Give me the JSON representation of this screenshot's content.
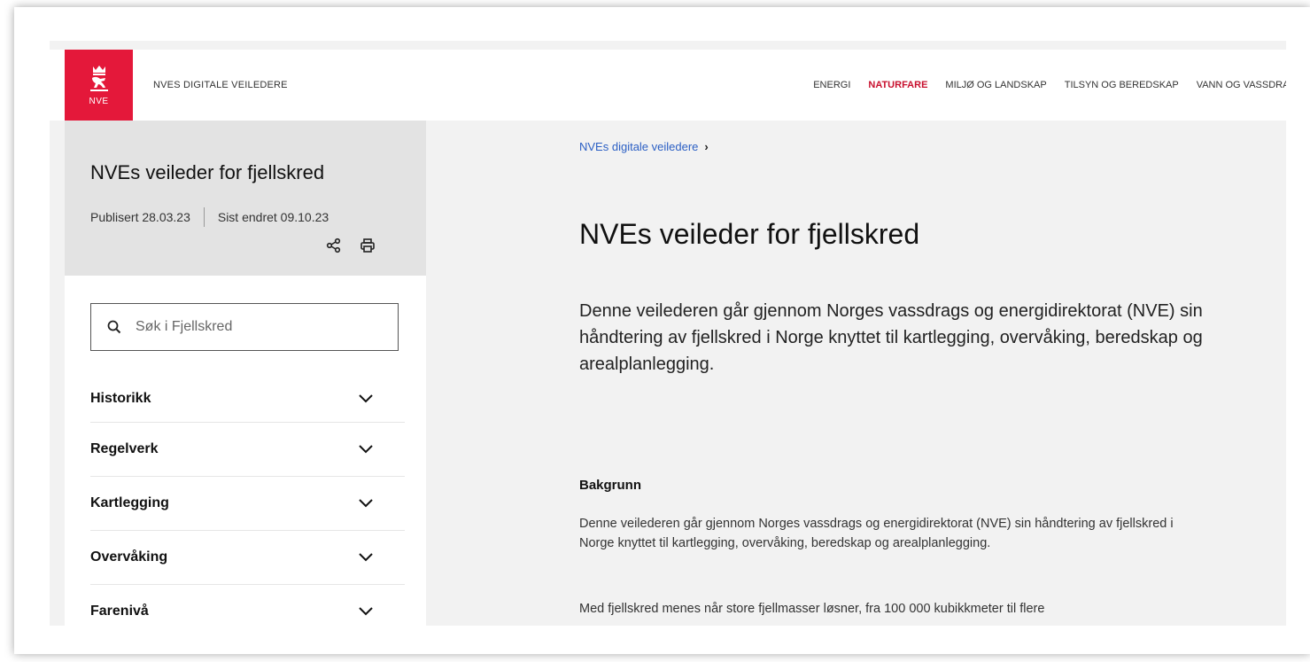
{
  "header": {
    "logo_text": "NVE",
    "site_name": "NVES DIGITALE VEILEDERE",
    "nav": [
      "ENERGI",
      "NATURFARE",
      "MILJØ OG LANDSKAP",
      "TILSYN OG BEREDSKAP",
      "VANN OG VASSDRAG"
    ],
    "active_nav": "NATURFARE"
  },
  "sidebar": {
    "title": "NVEs veileder for fjellskred",
    "published": "Publisert 28.03.23",
    "changed": "Sist endret 09.10.23",
    "search_placeholder": "Søk i Fjellskred",
    "items": [
      {
        "label": "Historikk"
      },
      {
        "label": "Regelverk"
      },
      {
        "label": "Kartlegging"
      },
      {
        "label": "Overvåking"
      },
      {
        "label": "Farenivå"
      }
    ]
  },
  "main": {
    "breadcrumb": "NVEs digitale veiledere",
    "breadcrumb_sep": "›",
    "title": "NVEs veileder for fjellskred",
    "lead": "Denne veilederen går gjennom Norges vassdrags og energidirektorat (NVE) sin håndtering av fjellskred i Norge knyttet til kartlegging, overvåking, beredskap og arealplanlegging.",
    "section_heading": "Bakgrunn",
    "paragraph1": "Denne veilederen går gjennom Norges vassdrags og energidirektorat (NVE) sin håndtering av fjellskred i Norge knyttet til kartlegging, overvåking, beredskap og arealplanlegging.",
    "paragraph2": "Med fjellskred menes når store fjellmasser løsner, fra 100 000 kubikkmeter til flere"
  },
  "colors": {
    "brand_red": "#e4183a",
    "active_nav": "#c8102e",
    "link_blue": "#2b5fc4"
  },
  "icons": [
    "crown-lion-logo-icon",
    "share-icon",
    "print-icon",
    "search-icon",
    "chevron-down-icon"
  ]
}
